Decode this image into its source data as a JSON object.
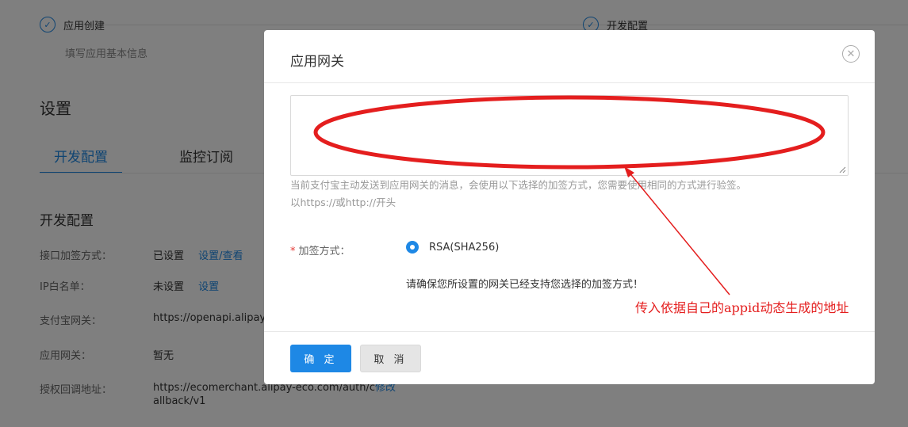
{
  "steps": {
    "step1": {
      "title": "应用创建",
      "desc": "填写应用基本信息"
    },
    "step2": {
      "title": "开发配置"
    }
  },
  "settings": {
    "heading": "设置",
    "tabs": [
      "开发配置",
      "监控订阅"
    ]
  },
  "dev_config": {
    "heading": "开发配置",
    "rows": [
      {
        "label": "接口加签方式：",
        "value": "已设置",
        "link": "设置/查看"
      },
      {
        "label": "IP白名单：",
        "value": "未设置",
        "link": "设置"
      },
      {
        "label": "支付宝网关：",
        "value": "https://openapi.alipay"
      },
      {
        "label": "应用网关：",
        "value": "暂无"
      },
      {
        "label": "授权回调地址：",
        "value": "https://ecomerchant.alipay-eco.com/auth/c",
        "value_line2": "allback/v1",
        "link": "修改"
      }
    ]
  },
  "modal": {
    "title": "应用网关",
    "textarea_value": "",
    "help_line1": "当前支付宝主动发送到应用网关的消息，会使用以下选择的加签方式，您需要使用相同的方式进行验签。",
    "help_line2": "以https://或http://开头",
    "sign_label": "加签方式：",
    "required_mark": "*",
    "radio_option": "RSA(SHA256)",
    "note": "请确保您所设置的网关已经支持您选择的加签方式！",
    "ok_label": "确 定",
    "cancel_label": "取 消"
  },
  "annotation": {
    "text": "传入依据自己的appid动态生成的地址",
    "color": "#e41e1e"
  },
  "icons": {
    "check": "check-icon",
    "close": "close-circle-icon"
  }
}
